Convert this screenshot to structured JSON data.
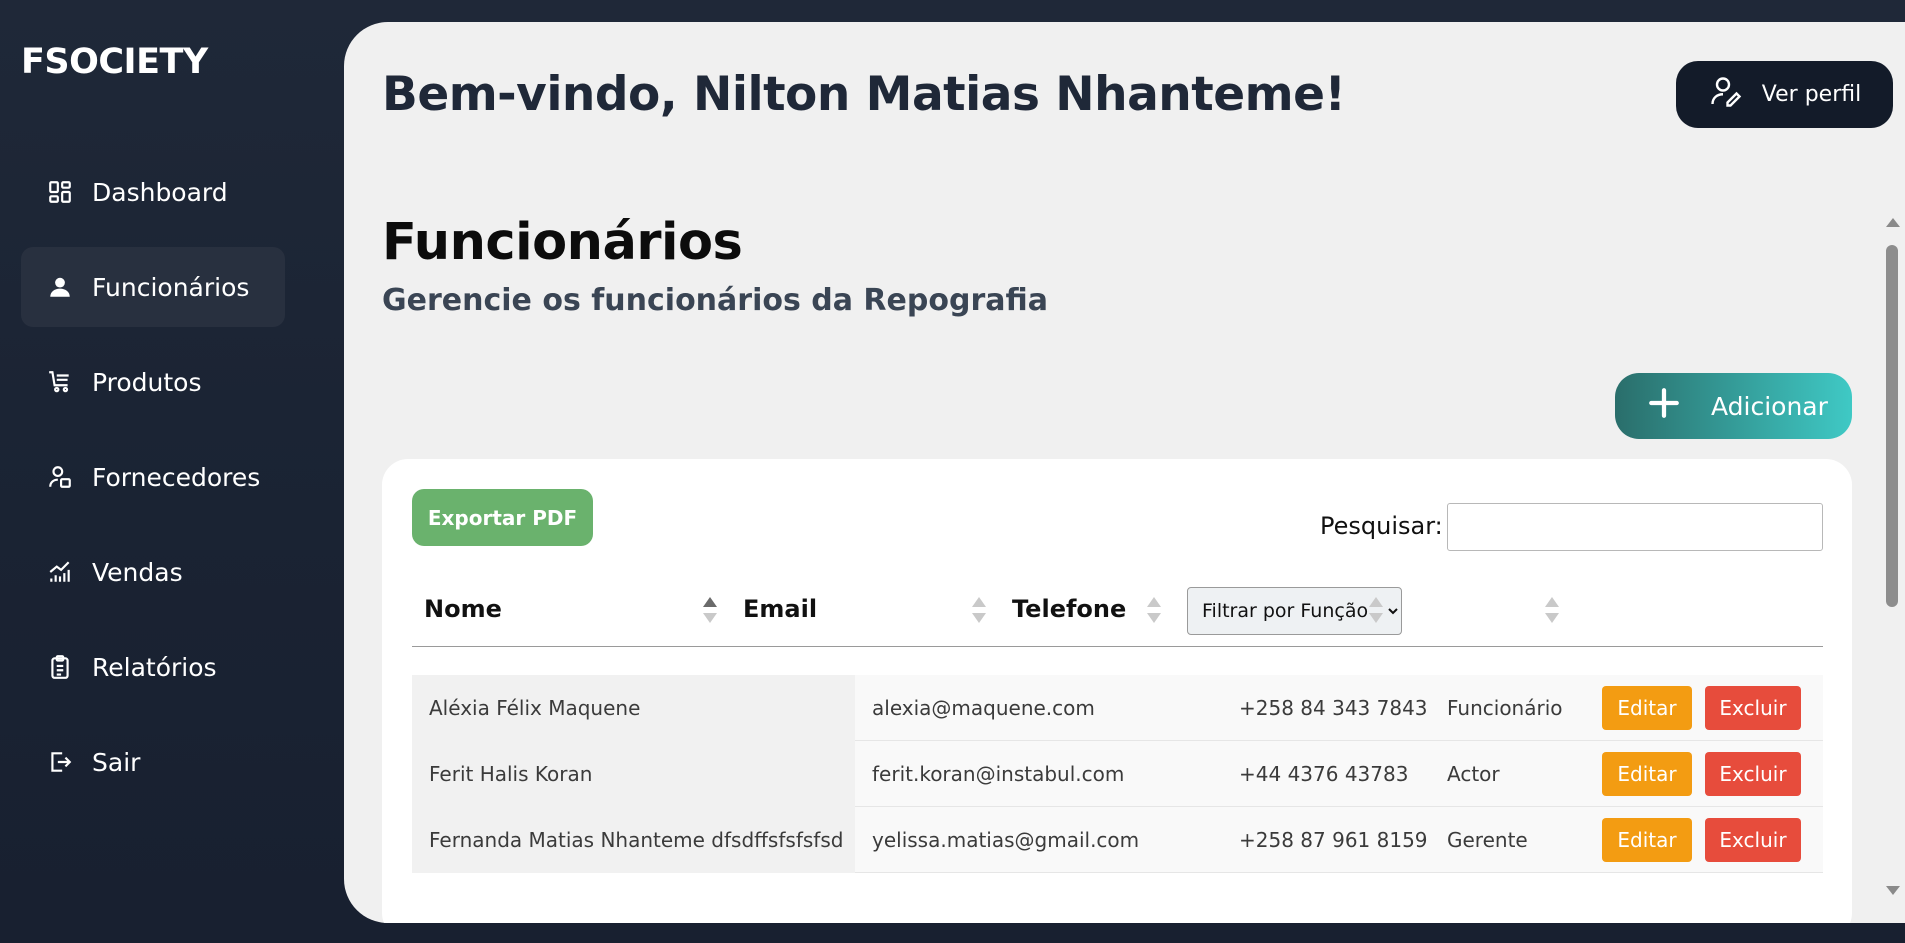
{
  "brand": "FSOCIETY",
  "sidebar": {
    "items": [
      {
        "label": "Dashboard",
        "icon": "dashboard-icon"
      },
      {
        "label": "Funcionários",
        "icon": "user-icon",
        "active": true
      },
      {
        "label": "Produtos",
        "icon": "cart-icon"
      },
      {
        "label": "Fornecedores",
        "icon": "supplier-icon"
      },
      {
        "label": "Vendas",
        "icon": "chart-icon"
      },
      {
        "label": "Relatórios",
        "icon": "clipboard-icon"
      },
      {
        "label": "Sair",
        "icon": "logout-icon"
      }
    ]
  },
  "header": {
    "welcome": "Bem-vindo, Nilton Matias Nhanteme!",
    "profile_button": "Ver perfil"
  },
  "page": {
    "title": "Funcionários",
    "subtitle": "Gerencie os funcionários da Repografia",
    "add_button": "Adicionar"
  },
  "table": {
    "export_button": "Exportar PDF",
    "search_label": "Pesquisar:",
    "search_value": "",
    "columns": {
      "name": "Nome",
      "email": "Email",
      "phone": "Telefone"
    },
    "filter_select": "Filtrar por Função",
    "rows": [
      {
        "name": "Aléxia Félix Maquene",
        "email": "alexia@maquene.com",
        "phone": "+258 84 343 7843",
        "role": "Funcionário",
        "edit": "Editar",
        "delete": "Excluir"
      },
      {
        "name": "Ferit Halis Koran",
        "email": "ferit.koran@instabul.com",
        "phone": "+44 4376 43783",
        "role": "Actor",
        "edit": "Editar",
        "delete": "Excluir"
      },
      {
        "name": "Fernanda Matias Nhanteme dfsdffsfsfsfsd",
        "email": "yelissa.matias@gmail.com",
        "phone": "+258 87 961 8159",
        "role": "Gerente",
        "edit": "Editar",
        "delete": "Excluir"
      }
    ]
  },
  "colors": {
    "sidebar_bg": "#1f2838",
    "main_bg": "#f0f0f0",
    "active_item": "#28303f",
    "export": "#6ab26d",
    "edit": "#f39c12",
    "delete": "#e74c3c",
    "add_gradient_start": "#2a6e6b",
    "add_gradient_end": "#3fc9c5"
  }
}
